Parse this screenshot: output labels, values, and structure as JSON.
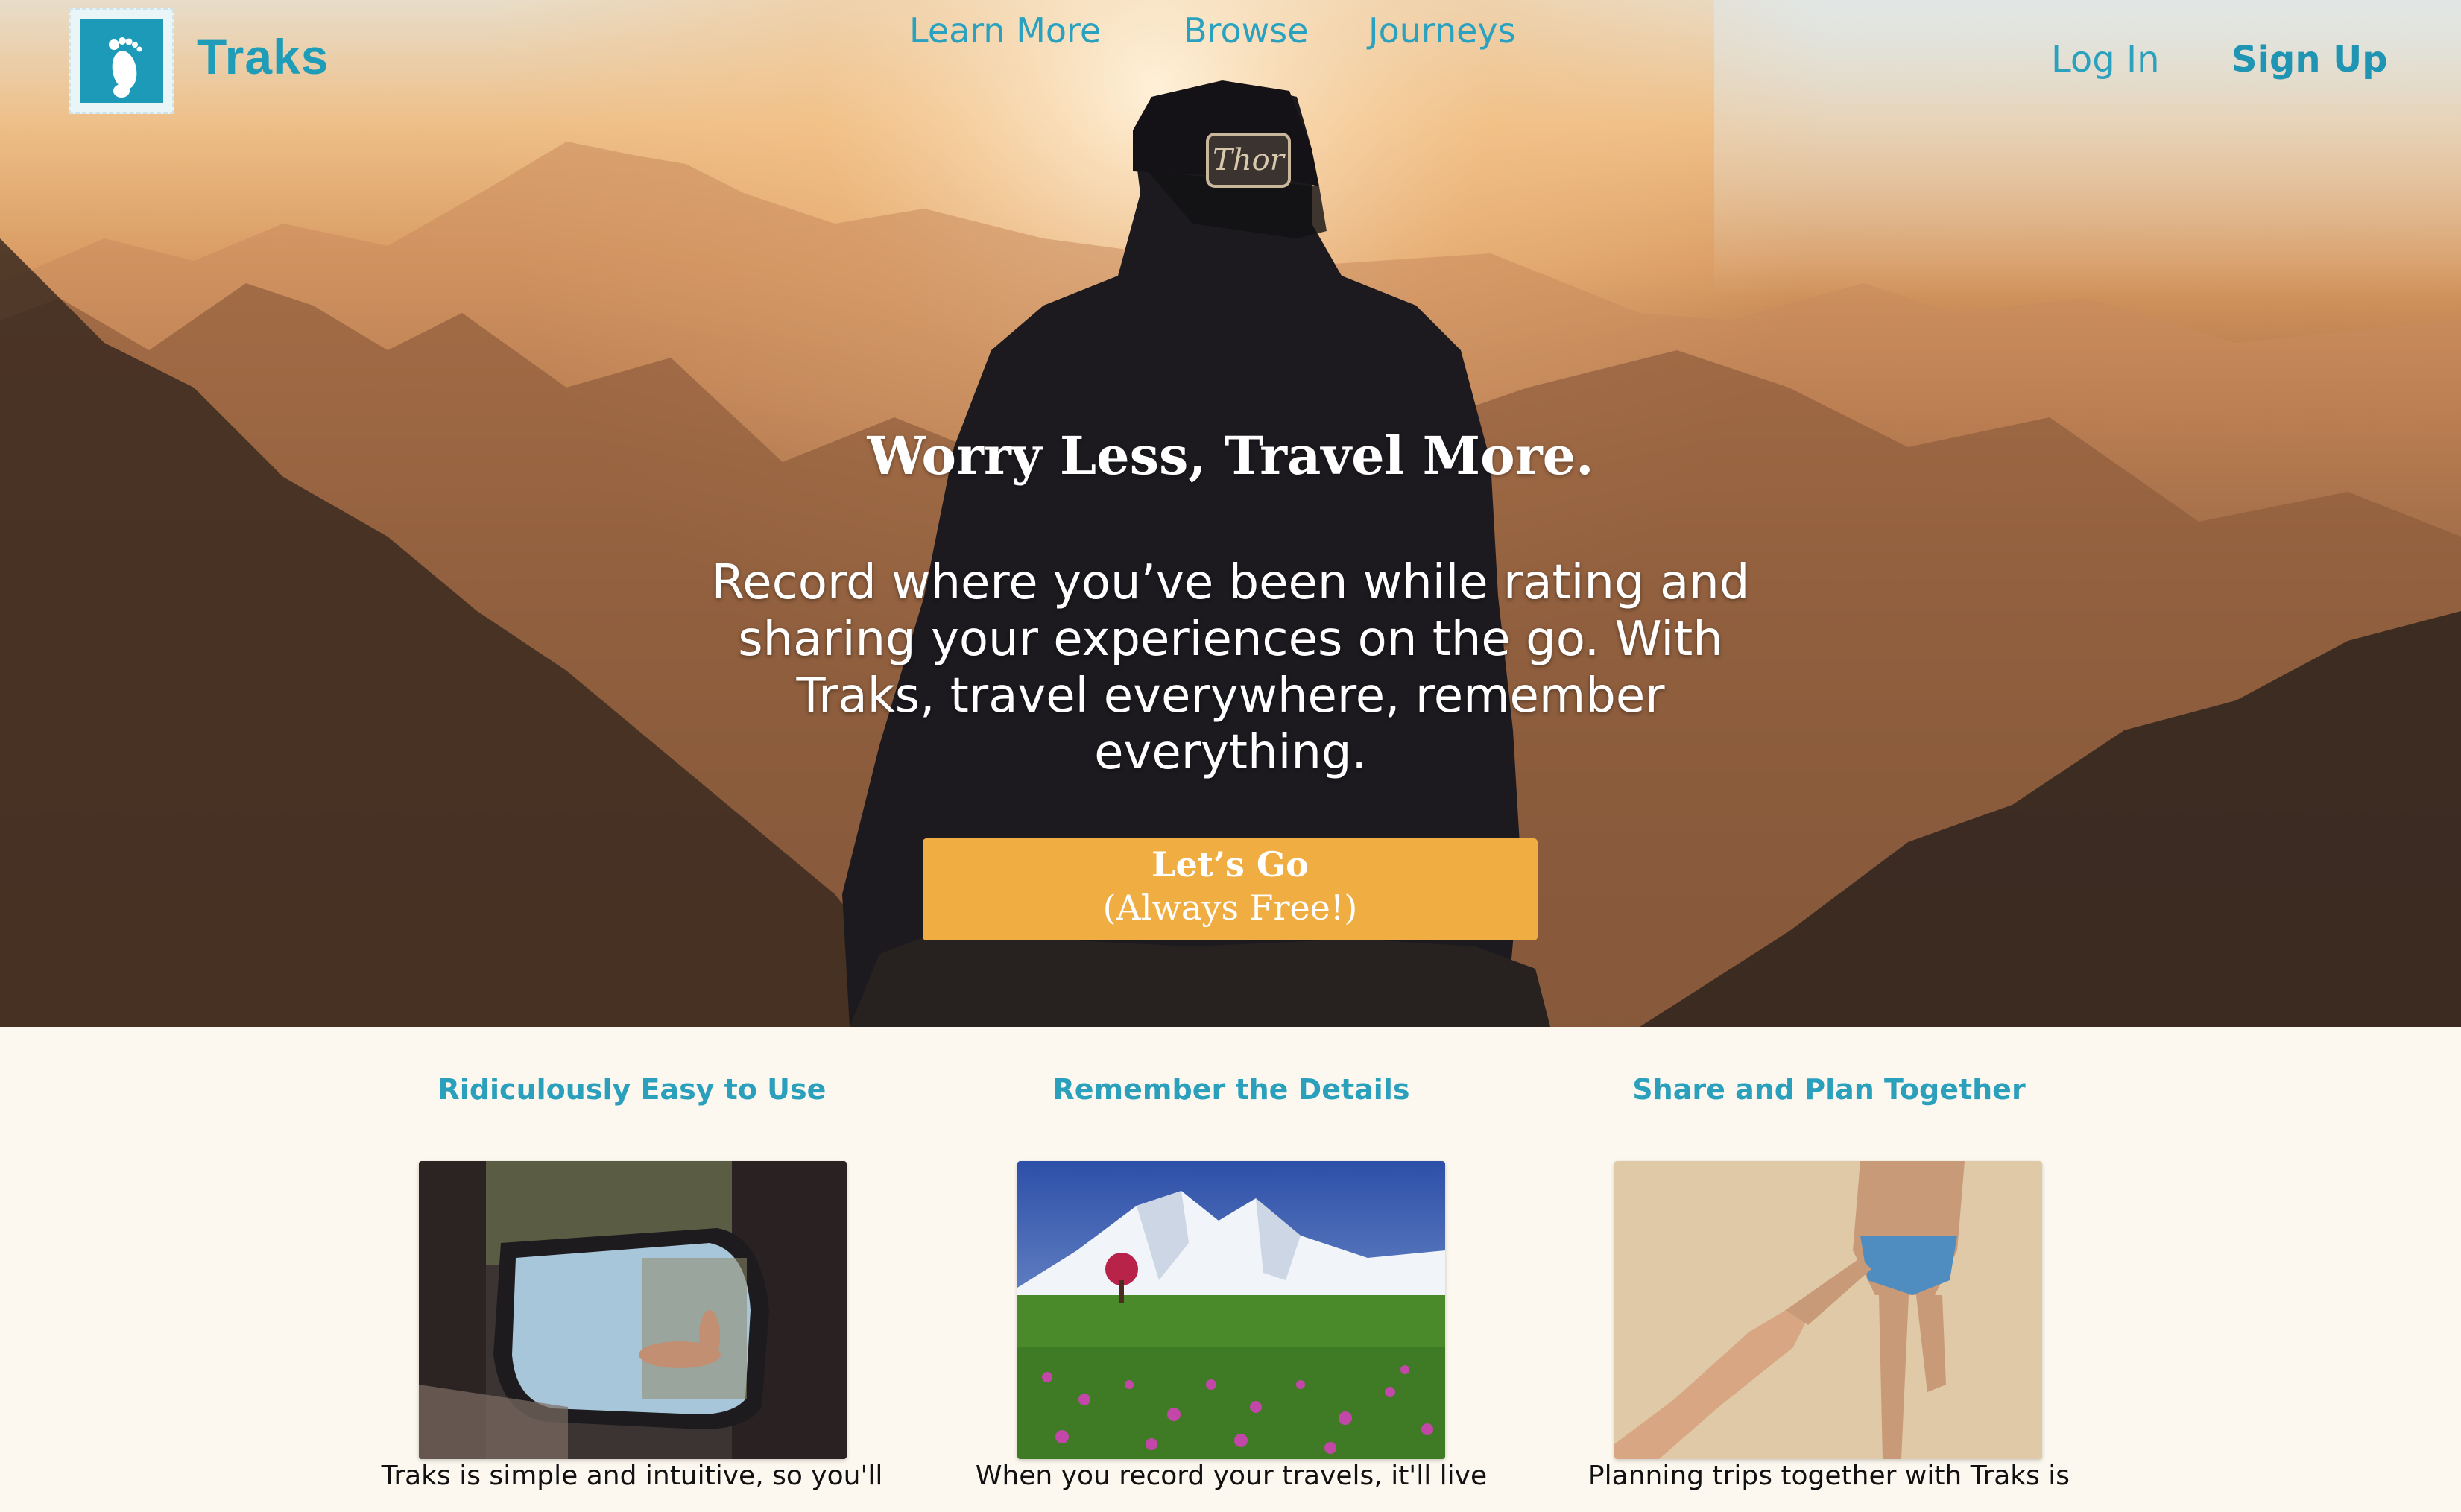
{
  "brand": {
    "name": "Traks",
    "logo_icon": "footprint-icon"
  },
  "nav": {
    "links": [
      "Learn More",
      "Browse",
      "Journeys"
    ],
    "login": "Log In",
    "signup": "Sign Up"
  },
  "hero": {
    "headline": "Worry Less, Travel More.",
    "subtext": "Record where you’ve been while rating and sharing your experiences on the go. With Traks, travel everywhere, remember everything.",
    "cta_line1": "Let’s Go",
    "cta_line2": "(Always Free!)"
  },
  "features": [
    {
      "title": "Ridiculously Easy to Use",
      "text": "Traks is simple and intuitive, so you'll"
    },
    {
      "title": "Remember the Details",
      "text": "When you record your travels, it'll live"
    },
    {
      "title": "Share and Plan Together",
      "text": "Planning trips together with Traks is"
    }
  ],
  "colors": {
    "accent": "#1f9db8",
    "cta": "#f0ad42",
    "background": "#fcf8ef"
  }
}
